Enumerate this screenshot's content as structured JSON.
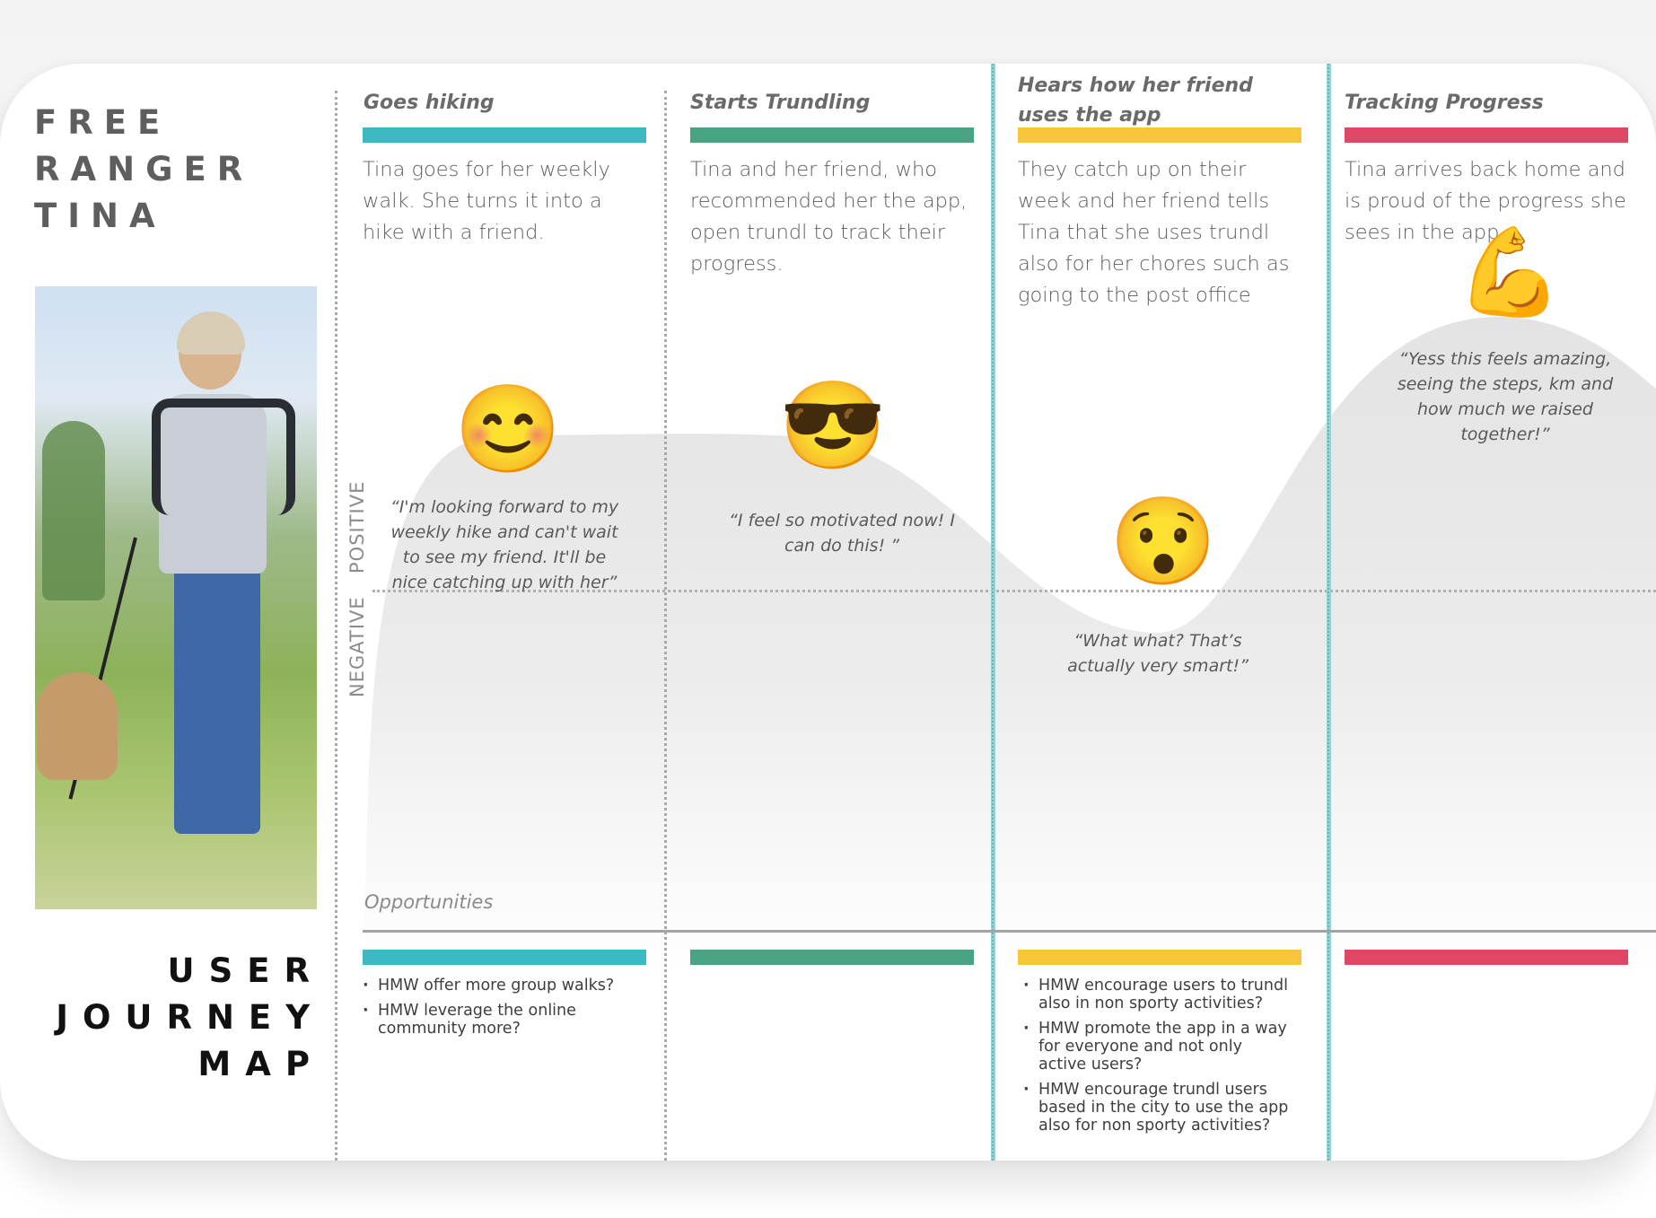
{
  "persona": {
    "name_lines": [
      "FREE",
      "RANGER",
      "TINA"
    ],
    "photo_alt": "Woman hiking with a dog in a grassy field"
  },
  "map_title_lines": [
    "USER",
    "JOURNEY",
    "MAP"
  ],
  "axis": {
    "positive": "POSITIVE",
    "negative": "NEGATIVE"
  },
  "colors": {
    "teal": "#3db9c4",
    "green": "#48a583",
    "yellow": "#f9c53a",
    "red": "#de4864",
    "highlight_line": "#8fd5d8"
  },
  "stages": [
    {
      "title": "Goes hiking",
      "color": "#3db9c4",
      "description": "Tina goes for her weekly walk. She turns it into a hike with a friend.",
      "emotion_icon": "smiling-face-icon",
      "emoji": "😊",
      "sentiment": 0.65,
      "quote": "“I'm looking forward to my weekly hike and can't wait to see my friend. It'll be nice catching up with her”",
      "opportunities": [
        "HMW offer more group walks?",
        "HMW leverage the online community more?"
      ]
    },
    {
      "title": "Starts Trundling",
      "color": "#48a583",
      "description": "Tina and her friend, who recommended her the app, open trundl to track their progress.",
      "emotion_icon": "sunglasses-face-icon",
      "emoji": "😎",
      "sentiment": 0.65,
      "quote": "“I feel so motivated now! I can do this! ”",
      "opportunities": []
    },
    {
      "title": "Hears how her friend uses the app",
      "color": "#f9c53a",
      "description": "They catch up on their week and her friend tells Tina that she uses trundl also for her chores such as going to the post office",
      "emotion_icon": "hushed-face-icon",
      "emoji": "😯",
      "sentiment": 0.15,
      "quote": "“What what? That’s actually very smart!”",
      "opportunities": [
        "HMW encourage users to trundl also in non sporty activities?",
        "HMW promote the app in a way for everyone and not only active users?",
        "HMW encourage trundl users based in the city to use the app also for non sporty activities?"
      ]
    },
    {
      "title": "Tracking Progress",
      "color": "#de4864",
      "description": "Tina arrives back home and is proud of the progress she sees in the app",
      "emotion_icon": "flexed-biceps-icon",
      "emoji": "💪",
      "sentiment": 0.95,
      "quote": "“Yess this feels amazing, seeing the steps, km and how much we raised together!”",
      "opportunities": []
    }
  ],
  "opportunities_label": "Opportunities"
}
